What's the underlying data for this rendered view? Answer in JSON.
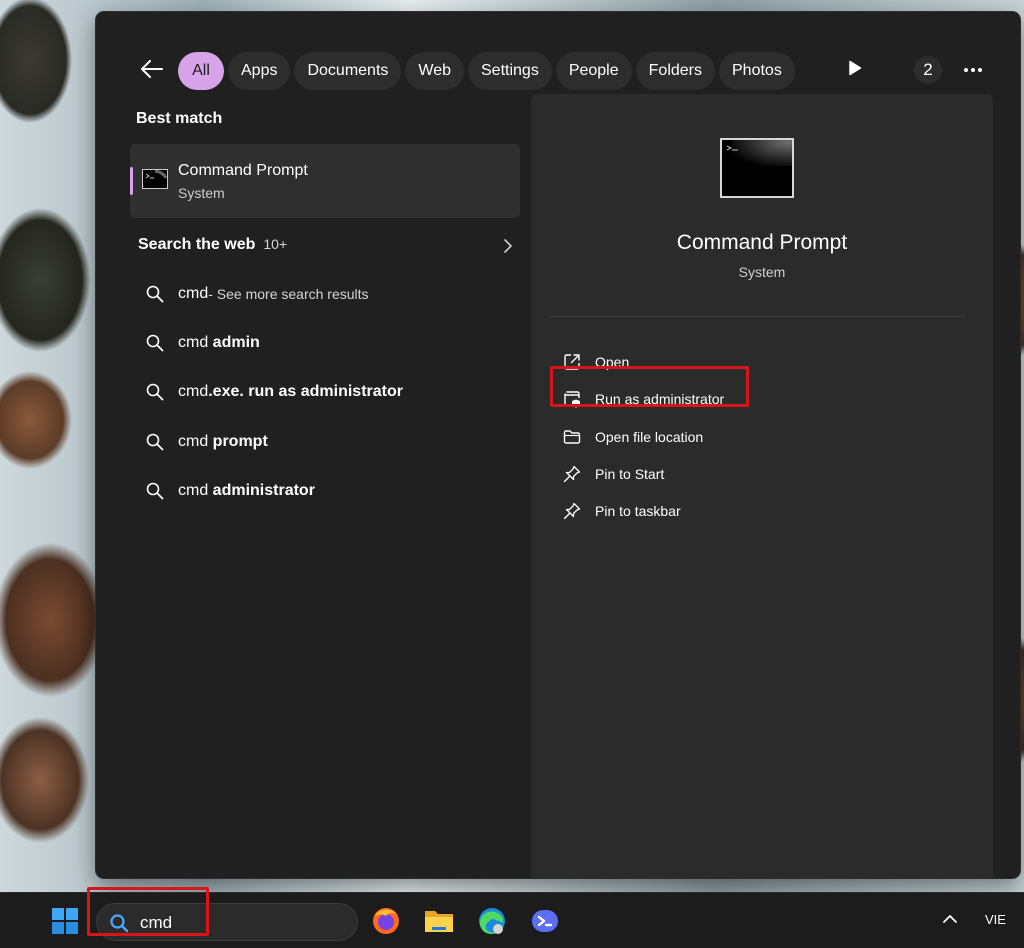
{
  "filters": {
    "chips": [
      {
        "label": "All",
        "active": true
      },
      {
        "label": "Apps"
      },
      {
        "label": "Documents"
      },
      {
        "label": "Web"
      },
      {
        "label": "Settings"
      },
      {
        "label": "People"
      },
      {
        "label": "Folders"
      },
      {
        "label": "Photos"
      }
    ],
    "count": "2"
  },
  "best_match": {
    "heading": "Best match",
    "title": "Command Prompt",
    "subtitle": "System"
  },
  "web": {
    "heading": "Search the web",
    "count": "10+",
    "suggestions": [
      {
        "prefix": "cmd",
        "bold": "",
        "muted": " - See more search results"
      },
      {
        "prefix": "cmd ",
        "bold": "admin",
        "muted": ""
      },
      {
        "prefix": "cmd",
        "bold": ".exe. run as administrator",
        "muted": ""
      },
      {
        "prefix": "cmd ",
        "bold": "prompt",
        "muted": ""
      },
      {
        "prefix": "cmd ",
        "bold": "administrator",
        "muted": ""
      }
    ]
  },
  "preview": {
    "title": "Command Prompt",
    "subtitle": "System",
    "actions": [
      {
        "label": "Open",
        "icon": "open-external-icon"
      },
      {
        "label": "Run as administrator",
        "icon": "shield-admin-icon"
      },
      {
        "label": "Open file location",
        "icon": "folder-icon"
      },
      {
        "label": "Pin to Start",
        "icon": "pin-icon"
      },
      {
        "label": "Pin to taskbar",
        "icon": "pin-icon"
      }
    ]
  },
  "taskbar": {
    "search_text": "cmd",
    "apps": [
      "firefox-icon",
      "file-explorer-icon",
      "edge-icon",
      "app-icon"
    ],
    "language": "VIE"
  },
  "colors": {
    "accent": "#d7a4ea",
    "panel": "#202020",
    "preview": "#2b2b2b",
    "highlight": "#d9151c"
  }
}
